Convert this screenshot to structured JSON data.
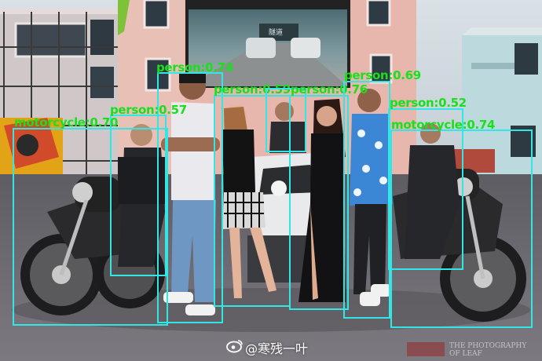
{
  "image": {
    "description_alt": "group-photo-with-motorcycles",
    "colors": {
      "box": "#33e6e6",
      "label": "#19e01c",
      "sky": "#cfd8de",
      "ground": "#6f6d72"
    }
  },
  "sign": {
    "text": "隧道"
  },
  "detections": [
    {
      "label": "person:0.74"
    },
    {
      "label": "person:0.57"
    },
    {
      "label": "motorcycle:0.70"
    },
    {
      "label": "person:0.59"
    },
    {
      "label": "person:0.76"
    },
    {
      "label": "person:0.69"
    },
    {
      "label": "person:0.52"
    },
    {
      "label": "motorcycle:0.74"
    }
  ],
  "watermark": {
    "text": "@寒残一叶"
  },
  "credit": {
    "line1": "THE PHOTOGRAPHY",
    "line2": "OF LEAF"
  }
}
